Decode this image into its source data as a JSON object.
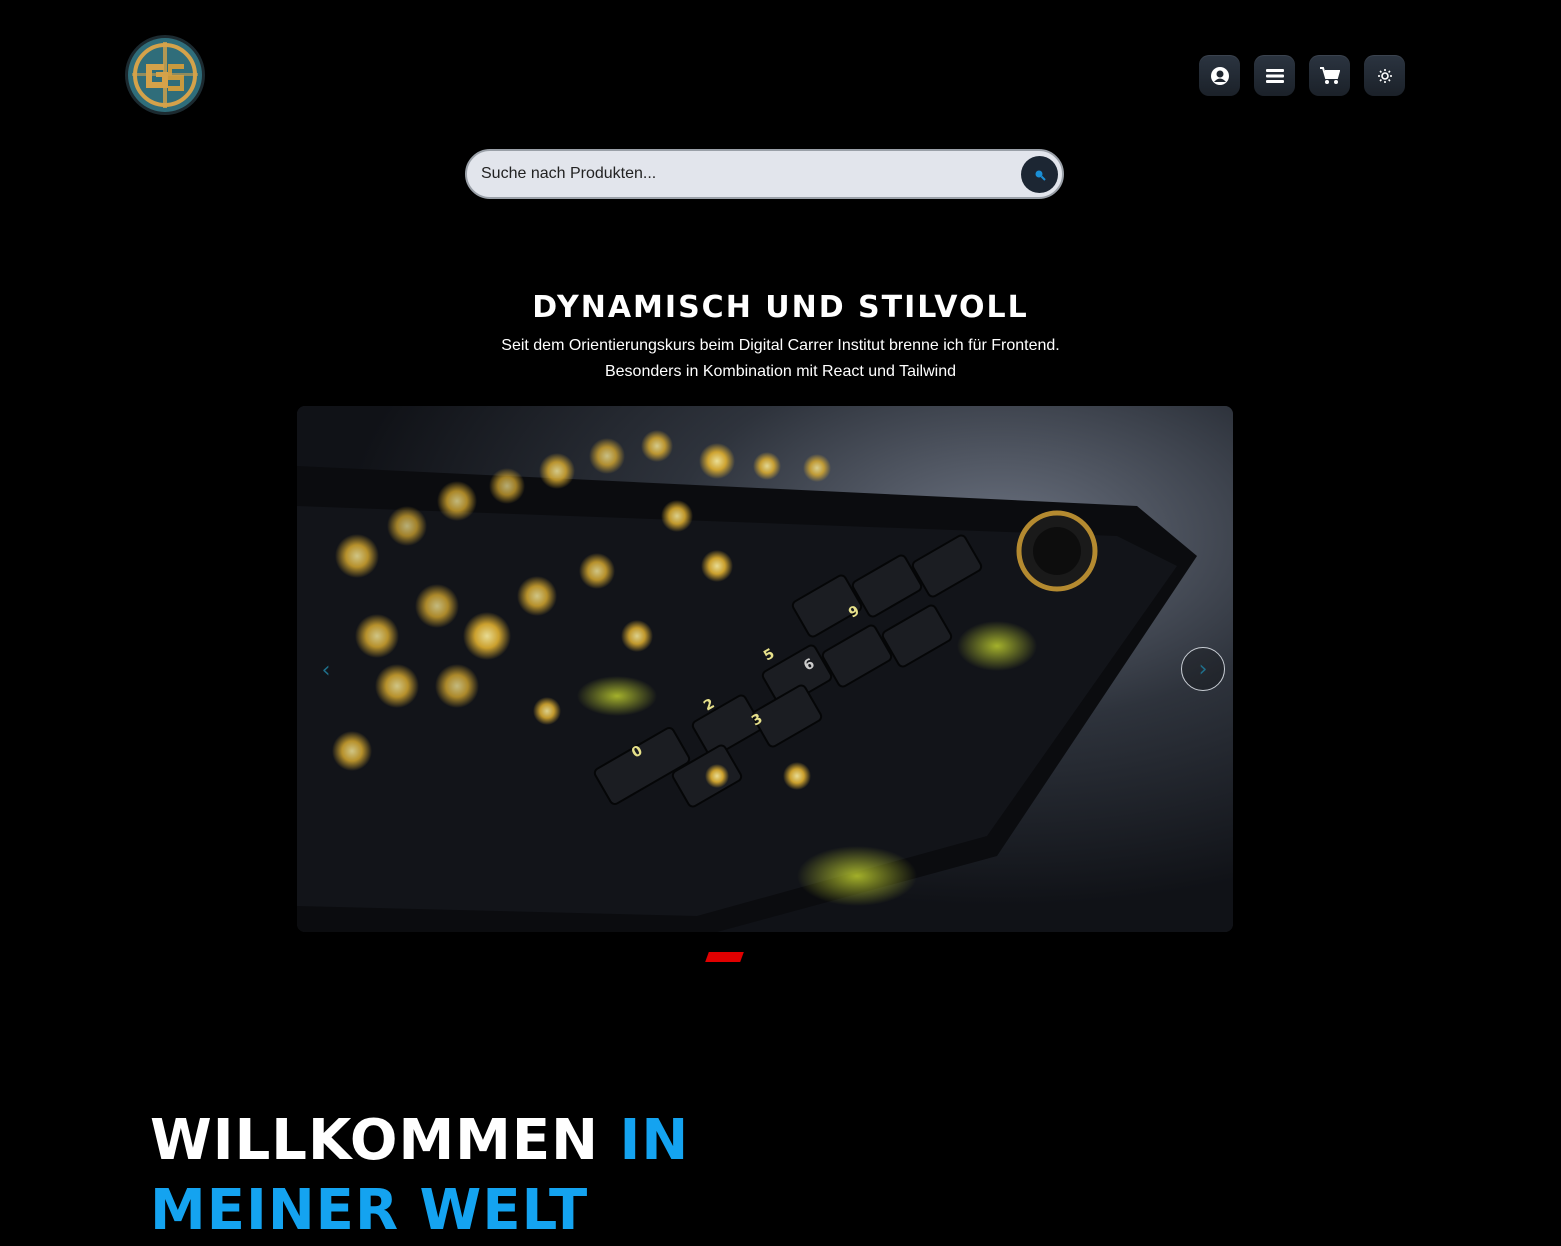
{
  "header": {
    "logo_alt": "GS",
    "nav": [
      {
        "icon": "user-icon"
      },
      {
        "icon": "menu-icon"
      },
      {
        "icon": "cart-icon"
      },
      {
        "icon": "theme-toggle-icon"
      }
    ]
  },
  "search": {
    "placeholder": "Suche nach Produkten...",
    "button_icon": "search-icon"
  },
  "hero": {
    "title": "DYNAMISCH UND STILVOLL",
    "subtitle_line1": "Seit dem Orientierungskurs beim Digital Carrer Institut brenne ich für Frontend.",
    "subtitle_line2": "Besonders in Kombination mit React und Tailwind"
  },
  "carousel": {
    "image_alt": "Beleuchtete Gaming-Tastatur",
    "prev_label": "‹",
    "next_label": "›",
    "slide_count": 1,
    "active_slide": 1
  },
  "welcome": {
    "part1": "WILLKOMMEN",
    "part2": "IN",
    "part3": "MEINER WELT"
  },
  "colors": {
    "background": "#000000",
    "accent_blue": "#14a3f0",
    "indicator_red": "#e00000",
    "logo_gold": "#d4a24a",
    "logo_teal": "#2f6d7a"
  }
}
